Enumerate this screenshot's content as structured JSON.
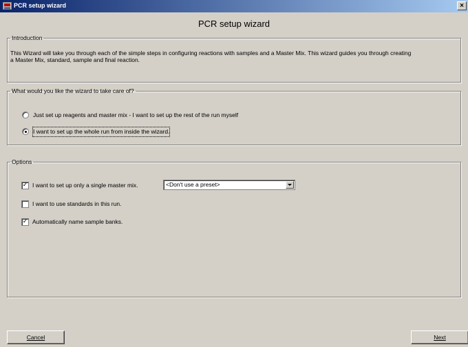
{
  "window": {
    "title": "PCR setup wizard"
  },
  "heading": "PCR setup wizard",
  "intro": {
    "legend": "Introduction",
    "text_line1": "This Wizard will take you through each of the simple steps in configuring reactions with samples and a Master Mix. This wizard guides you through creating",
    "text_line2": "a Master Mix, standard, sample and final reaction."
  },
  "scope": {
    "legend": "What would you like the wizard to take care of?",
    "options": [
      {
        "label": "Just set up reagents and master mix - I want to set up the rest of the run myself",
        "selected": false
      },
      {
        "label": "I want to set up the whole run from inside the wizard.",
        "selected": true
      }
    ]
  },
  "options": {
    "legend": "Options",
    "checkboxes": [
      {
        "label": "I want to set up only a single master mix.",
        "checked": true
      },
      {
        "label": "I want to use standards in this run.",
        "checked": false
      },
      {
        "label": "Automatically name sample banks.",
        "checked": true
      }
    ],
    "preset": {
      "value": "<Don't use a preset>"
    }
  },
  "buttons": {
    "cancel_label": "Cancel",
    "next_label": "Next"
  },
  "icons": {
    "app": "pcr-app-icon",
    "close": "close-icon",
    "dropdown": "chevron-down-icon"
  }
}
